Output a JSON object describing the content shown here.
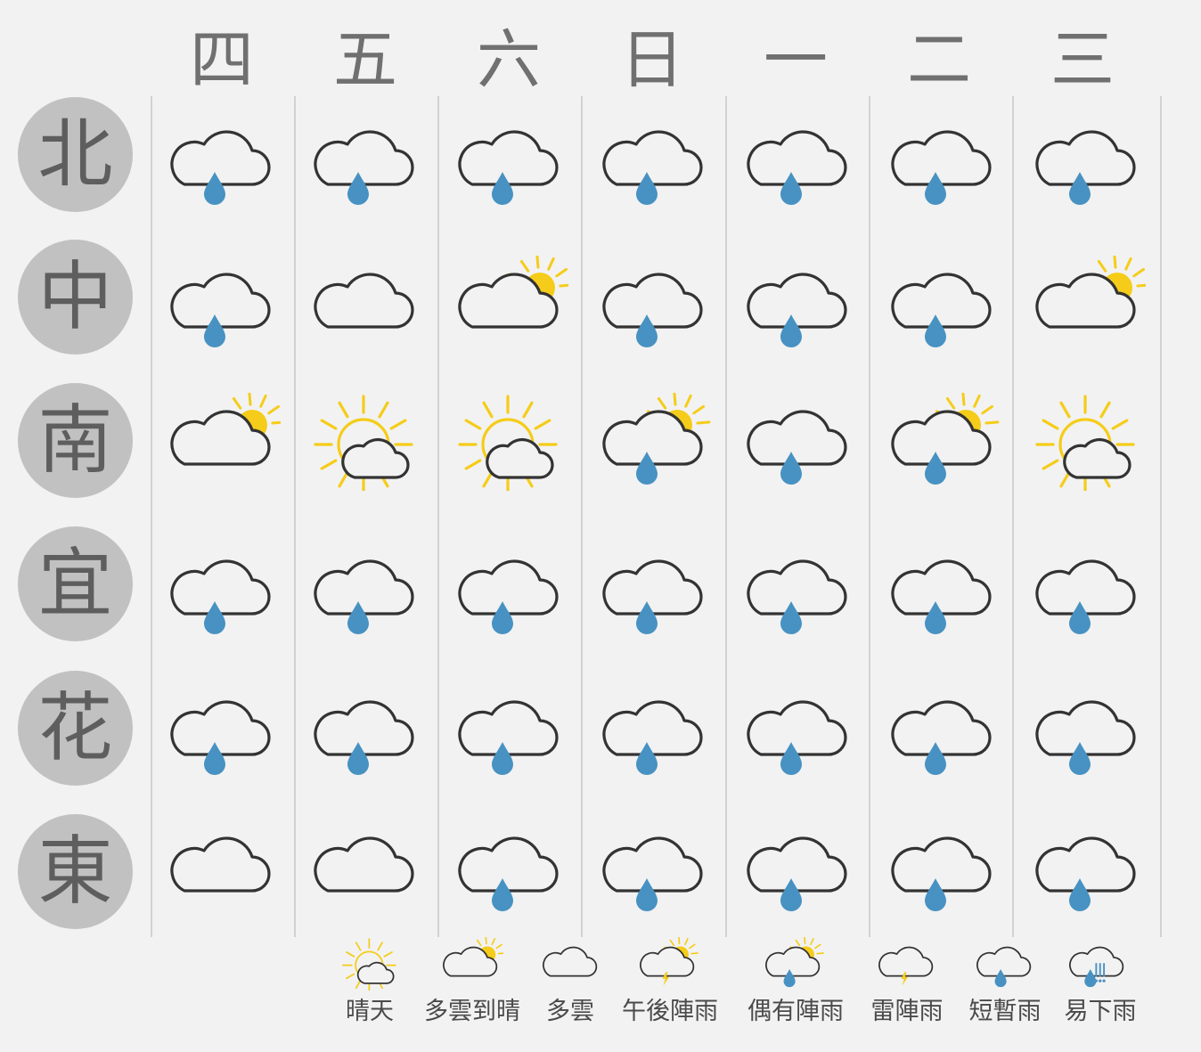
{
  "days": [
    "四",
    "五",
    "六",
    "日",
    "一",
    "二",
    "三"
  ],
  "regions": [
    "北",
    "中",
    "南",
    "宜",
    "花",
    "東"
  ],
  "grid": [
    [
      "short_rain",
      "short_rain",
      "short_rain",
      "short_rain",
      "short_rain",
      "short_rain",
      "short_rain"
    ],
    [
      "short_rain",
      "cloudy",
      "cloudy_sunny",
      "short_rain",
      "short_rain",
      "short_rain",
      "cloudy_sunny"
    ],
    [
      "cloudy_sunny",
      "sunny",
      "sunny",
      "afternoon_rain",
      "short_rain",
      "afternoon_rain",
      "sunny"
    ],
    [
      "short_rain",
      "short_rain",
      "short_rain",
      "short_rain",
      "short_rain",
      "short_rain",
      "short_rain"
    ],
    [
      "short_rain",
      "short_rain",
      "short_rain",
      "short_rain",
      "short_rain",
      "short_rain",
      "short_rain"
    ],
    [
      "cloudy",
      "cloudy",
      "short_rain",
      "short_rain",
      "short_rain",
      "short_rain",
      "short_rain"
    ]
  ],
  "legend": [
    {
      "type": "sunny",
      "label": "晴天",
      "icon": "sun-behind-cloud-icon"
    },
    {
      "type": "cloudy_sunny",
      "label": "多雲到晴",
      "icon": "cloud-with-sun-icon"
    },
    {
      "type": "cloudy",
      "label": "多雲",
      "icon": "cloud-icon"
    },
    {
      "type": "afternoon_thunder",
      "label": "午後陣雨",
      "icon": "cloud-sun-lightning-icon"
    },
    {
      "type": "afternoon_rain",
      "label": "偶有陣雨",
      "icon": "cloud-sun-rain-icon"
    },
    {
      "type": "thunder",
      "label": "雷陣雨",
      "icon": "cloud-lightning-icon"
    },
    {
      "type": "short_rain",
      "label": "短暫雨",
      "icon": "cloud-rain-icon"
    },
    {
      "type": "heavy_rain",
      "label": "易下雨",
      "icon": "cloud-heavy-rain-icon"
    }
  ],
  "colors": {
    "background": "#f2f2f2",
    "sun": "#f5cc19",
    "rain": "#4792c2",
    "cloud_outline": "#333333",
    "region_circle": "#c1c1c1",
    "day_text": "#707070"
  }
}
